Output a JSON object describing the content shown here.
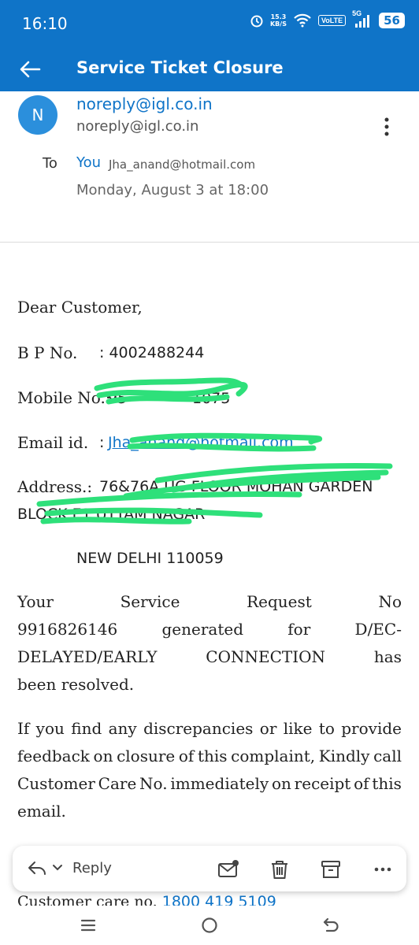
{
  "status_bar": {
    "time": "16:10",
    "net_speed_value": "15.3",
    "net_speed_unit": "KB/S",
    "volte": "VoLTE",
    "signal": "5G",
    "battery": "56"
  },
  "app_bar": {
    "title": "Service Ticket Closure",
    "accent": "#0f74c8"
  },
  "header": {
    "avatar_letter": "N",
    "sender_name": "noreply@igl.co.in",
    "sender_email": "noreply@igl.co.in",
    "to_label": "To",
    "to_you": "You",
    "to_email": "Jha_anand@hotmail.com",
    "date": "Monday, August 3 at 18:00"
  },
  "body": {
    "greeting": "Dear Customer,",
    "bp_label": "B P No.",
    "bp_value": ": 4002488244",
    "mobile_label": "Mobile No.:",
    "mobile_value": "95",
    "mobile_tail": "1075",
    "email_label": "Email id.",
    "email_colon": ":",
    "email_value": "Jha_anand@hotmail.com",
    "address_label": "Address.:",
    "address_line1": "76&76A  UG  FLOOR  MOHAN  GARDEN",
    "address_line2": "BLOCK E1  UTTAM NAGAR",
    "city": "NEW DELHI 110059",
    "para1_lines": [
      [
        "Your",
        "Service",
        "Request",
        "No"
      ],
      [
        "9916826146",
        "generated",
        "for",
        "D/EC-"
      ],
      [
        "DELAYED/EARLY",
        "CONNECTION",
        "has"
      ]
    ],
    "para1_last": "been resolved.",
    "para2_lines": [
      [
        "If",
        "you",
        "find",
        "any",
        "discrepancies",
        "or",
        "like",
        "to",
        "provide"
      ],
      [
        "feedback",
        "on",
        "closure",
        "of",
        "this",
        "complaint,",
        "Kindly",
        "call"
      ],
      [
        "Customer",
        "Care",
        "No.",
        "immediately",
        "on",
        "receipt",
        "of",
        "this"
      ]
    ],
    "para2_last": "email.",
    "footer_label": "Customer care no.",
    "footer_number": "1800 419 5109"
  },
  "action_bar": {
    "reply_label": "Reply"
  },
  "icons": {
    "back": "arrow-left-icon",
    "more": "more-vert-icon",
    "reply": "reply-icon",
    "mark_unread": "mail-unread-icon",
    "delete": "trash-icon",
    "archive": "archive-icon",
    "more_actions": "more-horiz-icon"
  },
  "colors": {
    "redaction": "#2ee07a",
    "link": "#0f74c8"
  }
}
